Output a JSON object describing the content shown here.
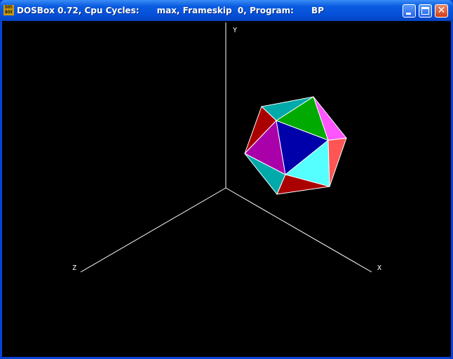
{
  "window": {
    "title": "DOSBox 0.72, Cpu Cycles:      max, Frameskip  0, Program:      BP",
    "icon_text": "DOS BOX"
  },
  "scene": {
    "axis_labels": {
      "x": "X",
      "y": "Y",
      "z": "Z"
    },
    "face_colors": [
      "#00aaaa",
      "#00aa00",
      "#ff55ff",
      "#aa0000",
      "#aa00aa",
      "#0000aa",
      "#55ffff",
      "#ff5555",
      "#00aaaa",
      "#aa0000"
    ]
  }
}
